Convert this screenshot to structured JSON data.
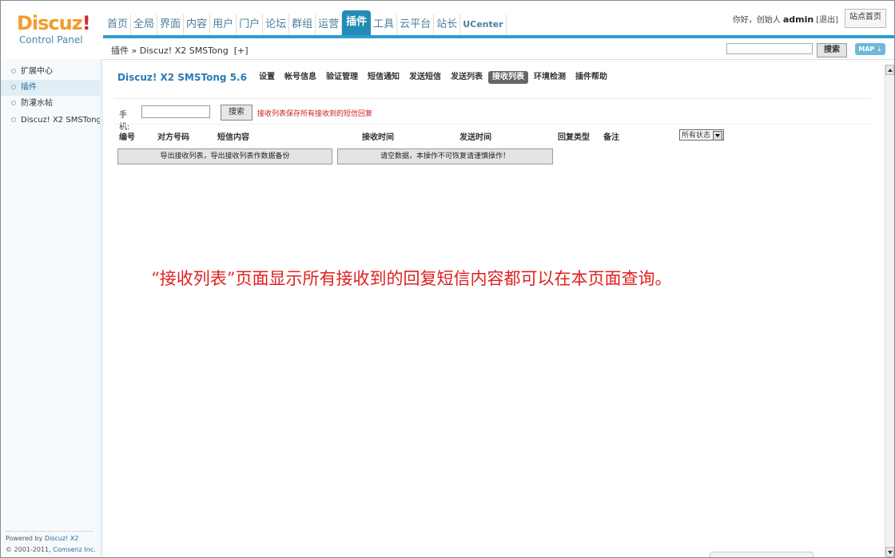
{
  "logo": {
    "brand": "Discuz",
    "mark": "!",
    "sub": "Control Panel"
  },
  "topnav": {
    "items": [
      "首页",
      "全局",
      "界面",
      "内容",
      "用户",
      "门户",
      "论坛",
      "群组",
      "运营",
      "插件",
      "工具",
      "云平台",
      "站长",
      "UCenter"
    ],
    "active": "插件"
  },
  "userbar": {
    "greeting": "你好，创始人",
    "username": "admin",
    "logout": "[退出]",
    "home": "站点首页"
  },
  "subbar": {
    "breadcrumb": "插件 » Discuz! X2 SMSTong",
    "breadcrumb_add": "[+]",
    "search_label": "搜索",
    "map_label": "MAP ⇣"
  },
  "sidebar": {
    "items": [
      "扩展中心",
      "插件",
      "防灌水帖",
      "Discuz! X2 SMSTong"
    ],
    "active_index": 1,
    "powered": "Powered by ",
    "powered_link": "Discuz! X2",
    "copy": "© 2001-2011, ",
    "copy_link": "Comsenz Inc."
  },
  "plugin": {
    "title": "Discuz! X2 SMSTong 5.6",
    "tabs": [
      "设置",
      "帐号信息",
      "验证管理",
      "短信通知",
      "发送短信",
      "发送列表",
      "接收列表",
      "环境检测",
      "插件帮助"
    ],
    "active_tab": "接收列表"
  },
  "form": {
    "phone_label": "手机:",
    "search_button": "搜索",
    "hint": "接收列表保存所有接收到的短信回复"
  },
  "table": {
    "headers": [
      "编号",
      "对方号码",
      "短信内容",
      "接收时间",
      "发送时间",
      "回复类型",
      "备注"
    ],
    "status_select": "所有状态"
  },
  "actions": {
    "export": "导出接收列表，导出接收列表作数据备份",
    "clear": "请空数据，本操作不可恢复请谨慎操作！"
  },
  "annotation": "“接收列表”页面显示所有接收到的回复短信内容都可以在本页面查询。",
  "colors": {
    "accent": "#238bb6",
    "logo": "#f19c2a",
    "hint": "#cc2222",
    "annotation": "#e02020"
  }
}
